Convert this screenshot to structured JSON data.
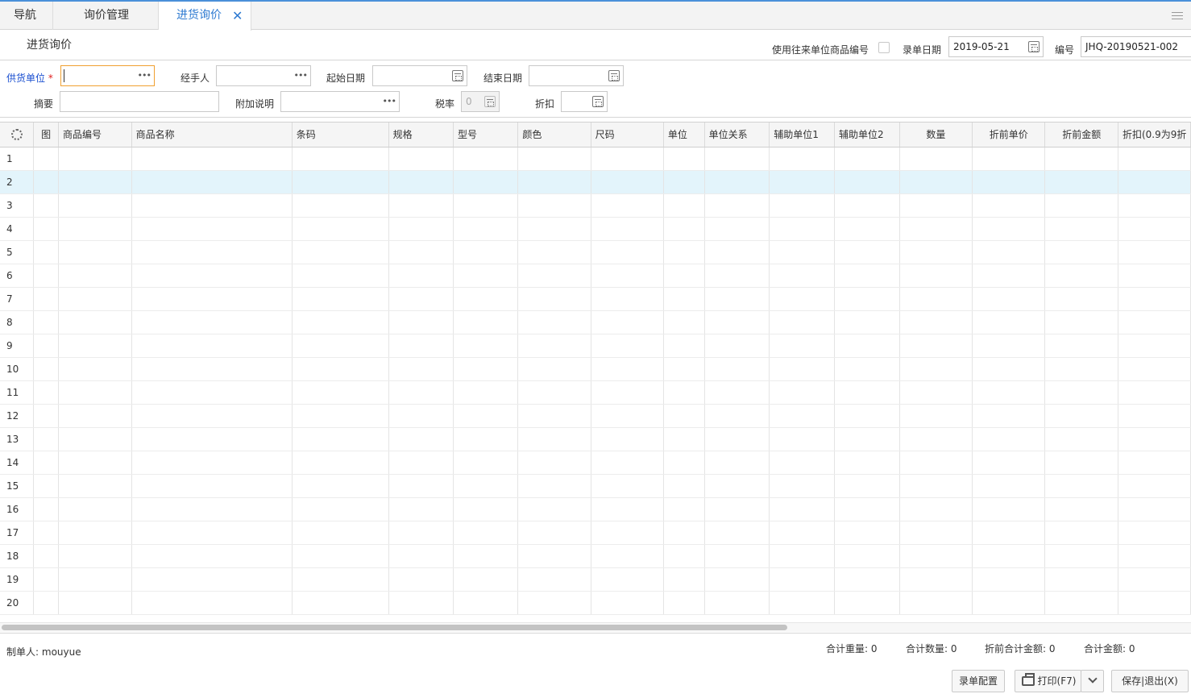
{
  "tabs": [
    {
      "label": "导航"
    },
    {
      "label": "询价管理"
    },
    {
      "label": "进货询价",
      "active": true
    }
  ],
  "page_title": "进货询价",
  "header": {
    "use_unit_code_label": "使用往来单位商品编号",
    "entry_date_label": "录单日期",
    "entry_date_value": "2019-05-21",
    "number_label": "编号",
    "number_value": "JHQ-20190521-002"
  },
  "form": {
    "supplier_label": "供货单位",
    "required_mark": "*",
    "handler_label": "经手人",
    "start_date_label": "起始日期",
    "end_date_label": "结束日期",
    "summary_label": "摘要",
    "extra_note_label": "附加说明",
    "tax_rate_label": "税率",
    "tax_rate_value": "0",
    "discount_label": "折扣"
  },
  "grid": {
    "columns": [
      "图",
      "商品编号",
      "商品名称",
      "条码",
      "规格",
      "型号",
      "颜色",
      "尺码",
      "单位",
      "单位关系",
      "辅助单位1",
      "辅助单位2",
      "数量",
      "折前单价",
      "折前金额",
      "折扣(0.9为9折"
    ],
    "rows": [
      "1",
      "2",
      "3",
      "4",
      "5",
      "6",
      "7",
      "8",
      "9",
      "10",
      "11",
      "12",
      "13",
      "14",
      "15",
      "16",
      "17",
      "18",
      "19",
      "20"
    ],
    "highlighted_row": "2"
  },
  "footer": {
    "creator_label": "制单人:",
    "creator_value": "mouyue",
    "total_weight_label": "合计重量:",
    "total_weight_value": "0",
    "total_qty_label": "合计数量:",
    "total_qty_value": "0",
    "total_pre_discount_label": "折前合计金额:",
    "total_pre_discount_value": "0",
    "total_amount_label": "合计金额:",
    "total_amount_value": "0",
    "config_button": "录单配置",
    "print_button": "打印(F7)",
    "save_exit_button": "保存|退出(X)"
  },
  "colors": {
    "accent": "#2e7ad1",
    "highlight_row": "#e3f4fb",
    "required": "#e02020"
  }
}
